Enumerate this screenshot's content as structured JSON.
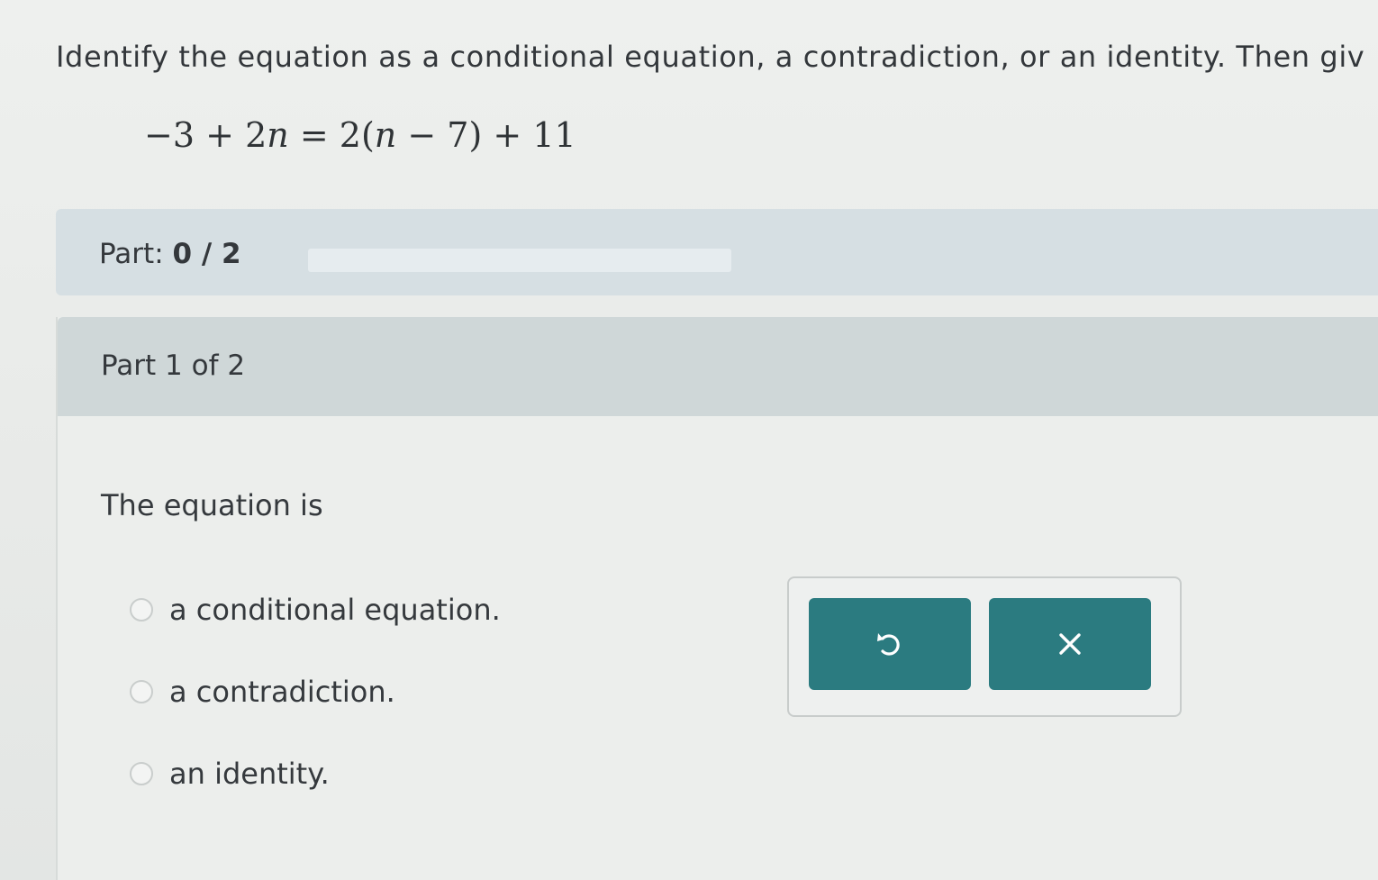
{
  "problem": {
    "prompt": "Identify the equation as a conditional equation, a contradiction, or an identity. Then giv",
    "equation": {
      "lhs_const": "−3",
      "plus1": "+",
      "lhs_coef": "2",
      "var1": "n",
      "eq": "=",
      "rhs_coef": "2",
      "open_paren": "(",
      "var2": "n",
      "minus": "−",
      "inner_const": "7",
      "close_paren": ")",
      "plus2": "+",
      "rhs_const": "11"
    }
  },
  "part_bar": {
    "label": "Part:",
    "count": "0 / 2",
    "progress": 0
  },
  "part": {
    "header": "Part 1 of 2",
    "stem": "The equation is",
    "options": [
      {
        "label": "a conditional equation.",
        "selected": false
      },
      {
        "label": "a contradiction.",
        "selected": false
      },
      {
        "label": "an identity.",
        "selected": false
      }
    ]
  },
  "toolbox": {
    "undo_icon": "undo-icon",
    "clear_icon": "close-icon",
    "button_color": "#2b7b80"
  }
}
